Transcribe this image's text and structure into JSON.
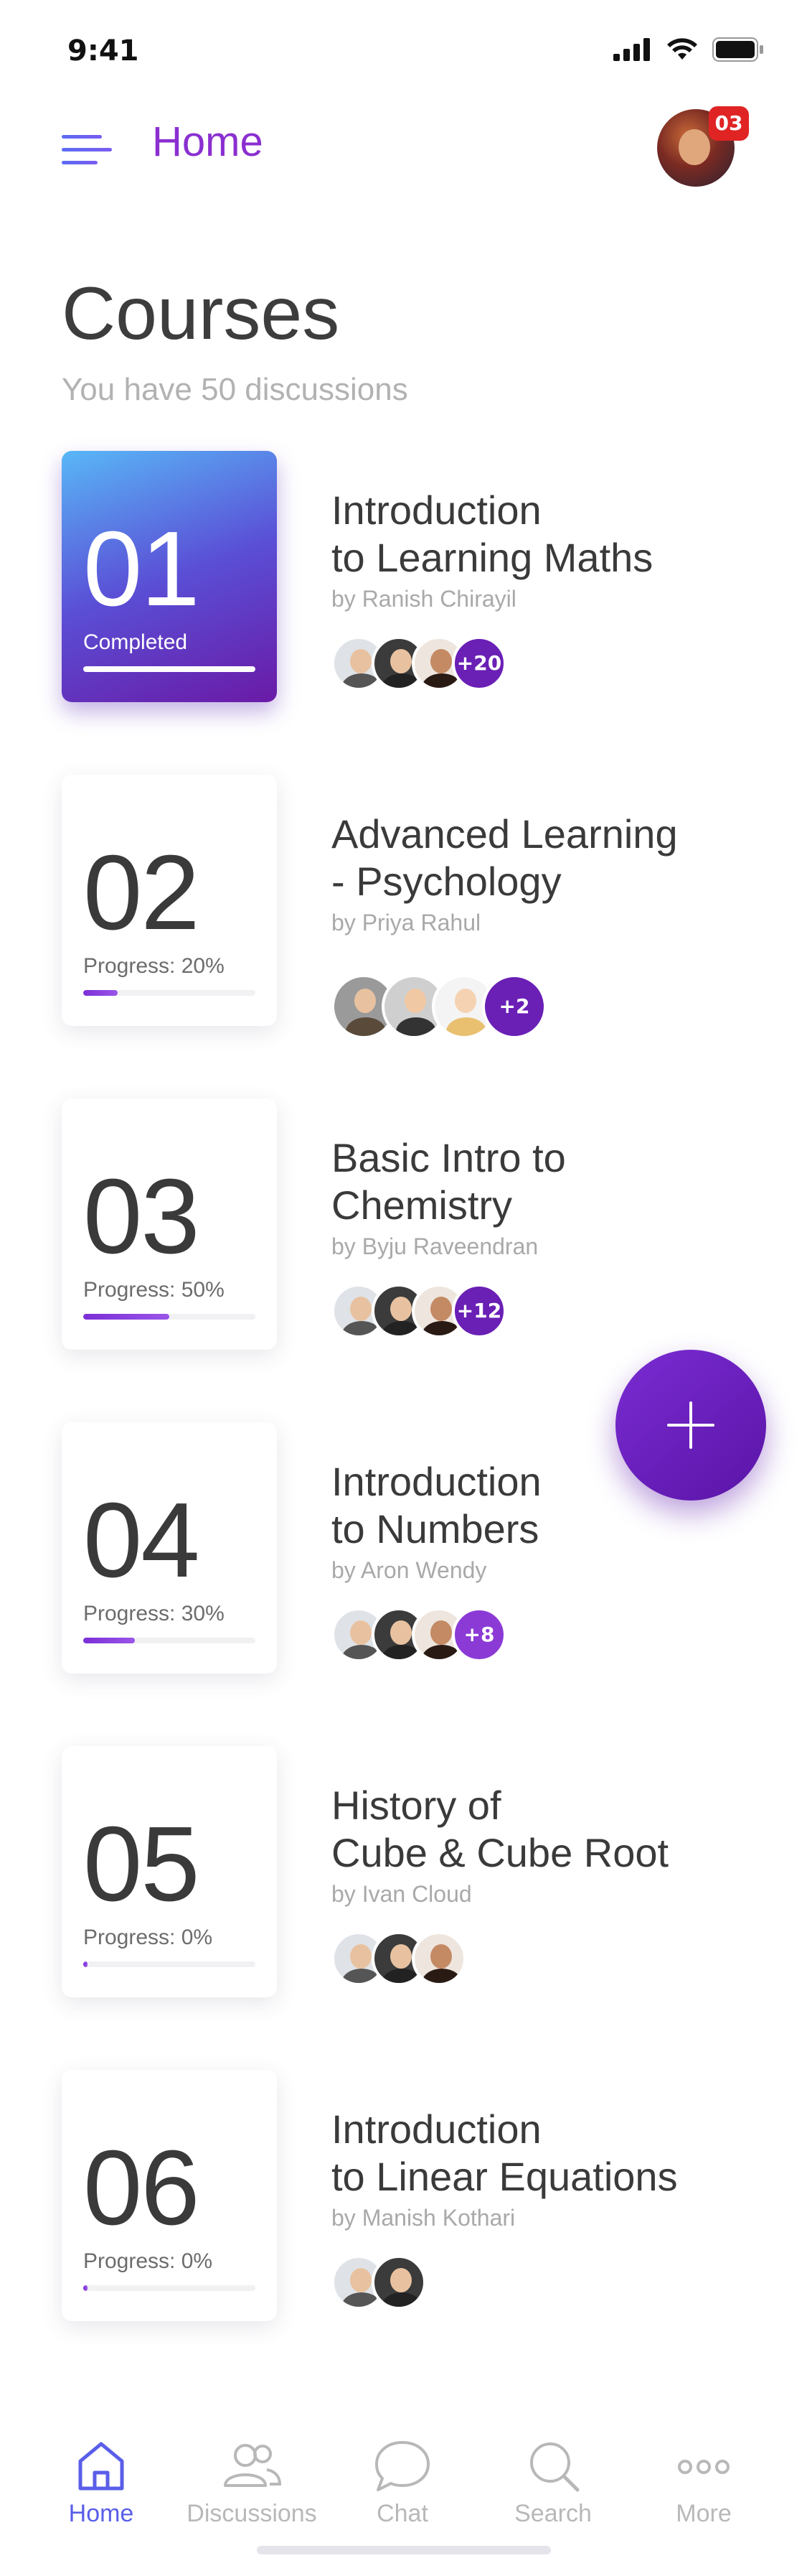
{
  "status_bar": {
    "time": "9:41"
  },
  "header": {
    "title": "Home",
    "notification_count": "03"
  },
  "main": {
    "heading": "Courses",
    "subheading": "You have 50 discussions"
  },
  "courses": [
    {
      "number": "01",
      "status": "Completed",
      "progress": 1.0,
      "title": "Introduction\nto Learning Maths",
      "author": "by Ranish Chirayil",
      "extra_count": "+20"
    },
    {
      "number": "02",
      "status": "Progress: 20%",
      "progress": 0.2,
      "title": "Advanced  Learning\n- Psychology",
      "author": "by Priya Rahul",
      "extra_count": "+2"
    },
    {
      "number": "03",
      "status": "Progress: 50%",
      "progress": 0.5,
      "title": "Basic Intro to\nChemistry",
      "author": "by Byju Raveendran",
      "extra_count": "+12"
    },
    {
      "number": "04",
      "status": "Progress: 30%",
      "progress": 0.3,
      "title": "Introduction\nto Numbers",
      "author": "by Aron Wendy",
      "extra_count": "+8"
    },
    {
      "number": "05",
      "status": "Progress: 0%",
      "progress": 0.0,
      "title": "History of\nCube & Cube Root",
      "author": "by Ivan Cloud",
      "extra_count": ""
    },
    {
      "number": "06",
      "status": "Progress: 0%",
      "progress": 0.0,
      "title": "Introduction\nto Linear Equations",
      "author": "by Manish Kothari",
      "extra_count": ""
    }
  ],
  "tab_bar": {
    "items": [
      {
        "label": "Home",
        "icon": "home-icon",
        "active": true
      },
      {
        "label": "Discussions",
        "icon": "people-icon",
        "active": false
      },
      {
        "label": "Chat",
        "icon": "chat-bubble-icon",
        "active": false
      },
      {
        "label": "Search",
        "icon": "search-icon",
        "active": false
      },
      {
        "label": "More",
        "icon": "more-dots-icon",
        "active": false
      }
    ]
  },
  "colors": {
    "accent": "#8a2fd0",
    "tab_active": "#5a5ee8",
    "badge": "#e02424"
  }
}
